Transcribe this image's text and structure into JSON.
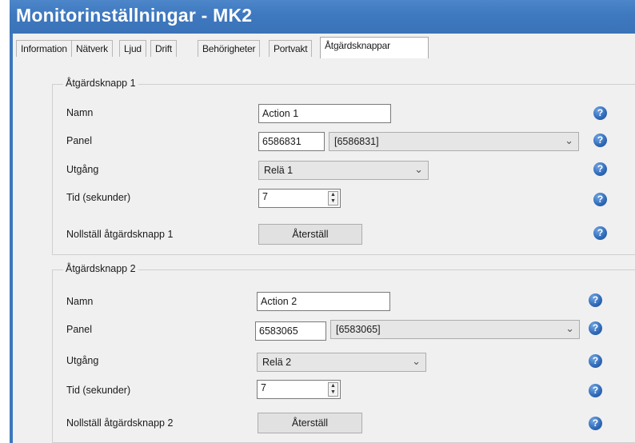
{
  "window": {
    "title": "Monitorinställningar - MK2"
  },
  "tabs": [
    {
      "label": "Information"
    },
    {
      "label": "Nätverk"
    },
    {
      "label": "Ljud"
    },
    {
      "label": "Drift"
    },
    {
      "label": "Behörigheter"
    },
    {
      "label": "Portvakt"
    },
    {
      "label": "Åtgärdsknappar",
      "active": true
    }
  ],
  "labels": {
    "name": "Namn",
    "panel": "Panel",
    "output": "Utgång",
    "time": "Tid (sekunder)"
  },
  "help_glyph": "?",
  "spin_glyphs": {
    "up": "▲",
    "down": "▼"
  },
  "combo_chevron": "⌄",
  "groups": [
    {
      "legend": "Åtgärdsknapp 1",
      "name_value": "Action 1",
      "panel_id": "6586831",
      "panel_select": "[6586831]",
      "output_value": "Relä 1",
      "time_value": "7",
      "reset_label": "Nollställ åtgärdsknapp 1",
      "reset_button": "Återställ"
    },
    {
      "legend": "Åtgärdsknapp 2",
      "name_value": "Action 2",
      "panel_id": "6583065",
      "panel_select": "[6583065]",
      "output_value": "Relä 2",
      "time_value": "7",
      "reset_label": "Nollställ åtgärdsknapp 2",
      "reset_button": "Återställ"
    }
  ],
  "colors": {
    "titlebar": "#3e78be",
    "help_icon": "#2f69b6"
  }
}
